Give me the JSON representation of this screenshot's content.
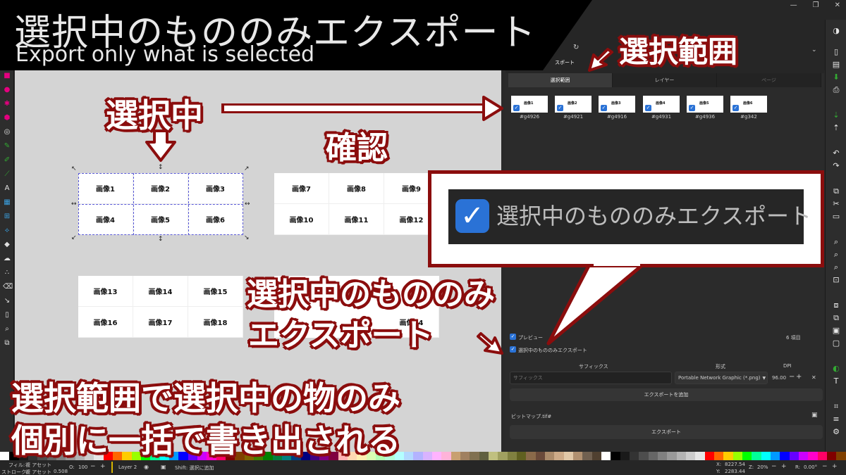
{
  "banner": {
    "title_ja": "選択中のもののみエクスポート",
    "title_en": "Export only what is selected"
  },
  "annotations": {
    "selection_range": "選択範囲",
    "selected": "選択中",
    "confirm": "確認",
    "export_only_line1": "選択中のもののみ",
    "export_only_line2": "エクスポート",
    "bottom_line1": "選択範囲で選択中の物のみ",
    "bottom_line2": "個別に一括で書き出される",
    "callout_text": "選択中のもののみエクスポート"
  },
  "canvas": {
    "group_a": [
      "画像1",
      "画像2",
      "画像3",
      "画像4",
      "画像5",
      "画像6"
    ],
    "group_b": [
      "画像7",
      "画像8",
      "画像9",
      "画像10",
      "画像11",
      "画像12"
    ],
    "group_c": [
      "画像13",
      "画像14",
      "画像15",
      "画像16",
      "画像17",
      "画像18"
    ],
    "group_d_visible": "画像24"
  },
  "panel": {
    "tab_partial": "スポート",
    "tabs": [
      "選択範囲",
      "レイヤー",
      "ページ"
    ],
    "thumbs": [
      {
        "id": "#g4926",
        "mini": "画像1"
      },
      {
        "id": "#g4921",
        "mini": "画像2"
      },
      {
        "id": "#g4916",
        "mini": "画像3"
      },
      {
        "id": "#g4931",
        "mini": "画像4"
      },
      {
        "id": "#g4936",
        "mini": "画像5"
      },
      {
        "id": "#g342",
        "mini": "画像6"
      }
    ],
    "preview_label": "プレビュー",
    "item_count": "6 項目",
    "only_selected_label": "選択中のもののみエクスポート",
    "suffix_header": "サフィックス",
    "format_header": "形式",
    "dpi_header": "DPI",
    "suffix_placeholder": "サフィックス",
    "format_value": "Portable Network Graphic (*.png)",
    "dpi_value": "96.00",
    "add_export_button": "エクスポートを追加",
    "filename": "ビットマップ.tif#",
    "export_button": "エクスポート"
  },
  "status": {
    "fill_label": "フィル:",
    "fill_value": "複 アセット",
    "stroke_label": "ストローク:",
    "stroke_value": "複 アセット",
    "stroke_width": "0.508",
    "opacity_label": "O:",
    "opacity_value": "100",
    "layer": "Layer 2",
    "hint": "Shift: 選択に追加",
    "x_label": "X:",
    "x_value": "8227.54",
    "y_label": "Y:",
    "y_value": "2283.44",
    "zoom_label": "Z:",
    "zoom_value": "20%",
    "rotate_label": "R:",
    "rotate_value": "0.00°"
  },
  "colors": {
    "annotation_red": "#8b0d0d",
    "check_blue": "#2a72d6",
    "canvas_bg": "#d4d4d4"
  }
}
